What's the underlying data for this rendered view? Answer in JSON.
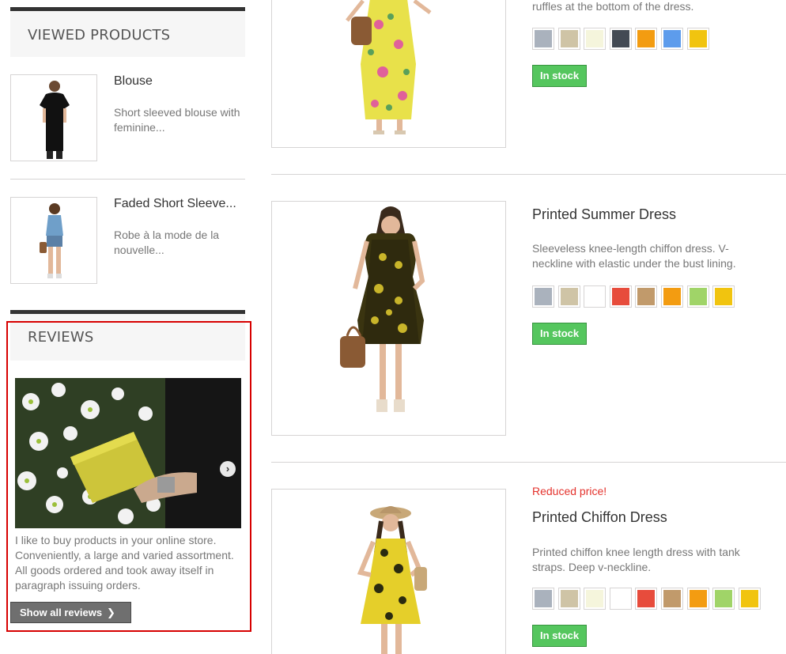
{
  "viewed_products": {
    "title": "VIEWED PRODUCTS",
    "items": [
      {
        "name": "Blouse",
        "description": "Short sleeved blouse with feminine..."
      },
      {
        "name": "Faded Short Sleeve...",
        "description": "Robe à la mode de la nouvelle..."
      }
    ]
  },
  "reviews": {
    "title": "REVIEWS",
    "text": "I like to buy products in your online store. Conveniently, a large and varied assortment. All goods ordered and took away itself in paragraph issuing orders.",
    "show_all_label": "Show all reviews",
    "next_icon": "chevron-right-circle-icon"
  },
  "products": [
    {
      "name": "",
      "description_tail": "ruffles at the bottom of the dress.",
      "colors": [
        "#aab2bd",
        "#cfc4a6",
        "#f5f5dc",
        "#434a54",
        "#f39c11",
        "#5d9cec",
        "#f1c40f"
      ],
      "stock_label": "In stock"
    },
    {
      "name": "Printed Summer Dress",
      "description": "Sleeveless knee-length chiffon dress. V-neckline with elastic under the bust lining.",
      "colors": [
        "#aab2bd",
        "#cfc4a6",
        "#ffffff",
        "#e74c3c",
        "#c19a6b",
        "#f39c11",
        "#a0d468",
        "#f1c40f"
      ],
      "stock_label": "In stock"
    },
    {
      "flag": "Reduced price!",
      "name": "Printed Chiffon Dress",
      "description": "Printed chiffon knee length dress with tank straps. Deep v-neckline.",
      "colors": [
        "#aab2bd",
        "#cfc4a6",
        "#f5f5dc",
        "#ffffff",
        "#e74c3c",
        "#c19a6b",
        "#f39c11",
        "#a0d468",
        "#f1c40f"
      ],
      "stock_label": "In stock"
    }
  ]
}
